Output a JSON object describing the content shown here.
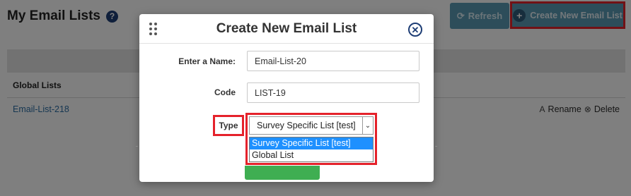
{
  "page": {
    "title": "My Email Lists",
    "refresh_label": "Refresh",
    "create_label": "Create New Email List",
    "section_heading": "Global Lists",
    "rows": [
      {
        "name": "Email-List-218",
        "rename_label": "Rename",
        "delete_label": "Delete"
      }
    ]
  },
  "modal": {
    "title": "Create New Email List",
    "name_label": "Enter a Name:",
    "name_value": "Email-List-20",
    "code_label": "Code",
    "code_value": "LIST-19",
    "type_label": "Type",
    "type_selected": "Survey Specific List [test]",
    "type_options": [
      "Survey Specific List [test]",
      "Global List"
    ]
  },
  "icons": {
    "help": "question-circle-icon",
    "refresh": "refresh-icon",
    "add": "plus-circle-icon",
    "drag": "drag-handle-icon",
    "close": "close-circle-icon",
    "rename": "rename-icon",
    "delete": "delete-circle-icon",
    "select_arrow": "chevron-down-icon"
  },
  "colors": {
    "accent_button": "#5b9ab5",
    "highlight_red": "#e5222b",
    "link": "#2c6ea5",
    "selected_option": "#1e90ff",
    "submit_button": "#3fae52"
  }
}
